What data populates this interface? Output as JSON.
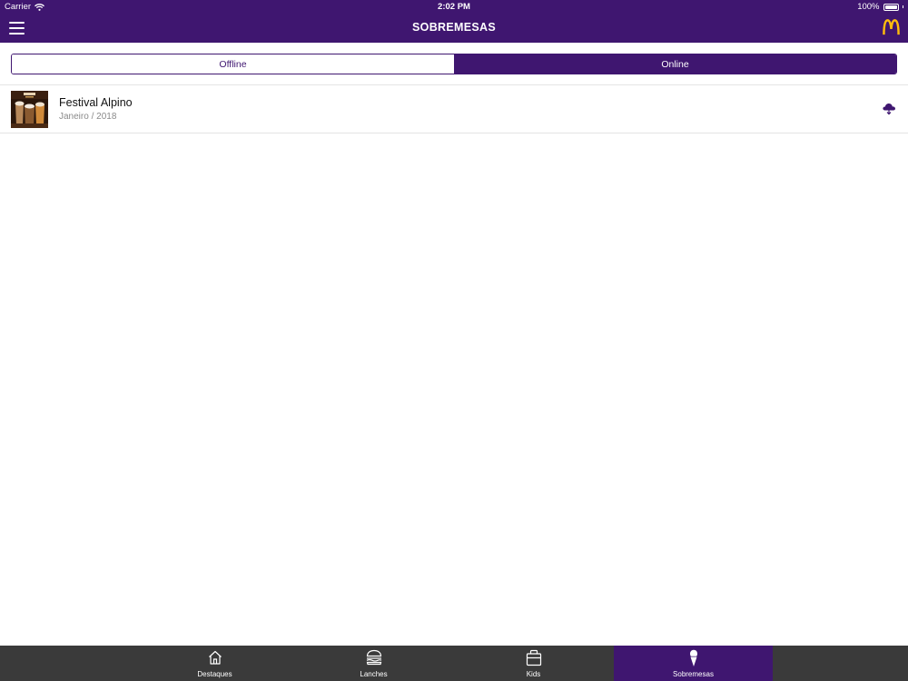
{
  "status_bar": {
    "carrier": "Carrier",
    "time": "2:02 PM",
    "battery": "100%"
  },
  "nav": {
    "title": "SOBREMESAS",
    "menu_icon": "hamburger-menu-icon",
    "logo": "mcdonalds-logo"
  },
  "segments": {
    "offline": "Offline",
    "online": "Online",
    "selected": "Online"
  },
  "items": [
    {
      "title": "Festival Alpino",
      "subtitle": "Janeiro / 2018",
      "action_icon": "cloud-download-icon"
    }
  ],
  "tabs": [
    {
      "label": "Destaques",
      "icon": "home-icon"
    },
    {
      "label": "Lanches",
      "icon": "burger-icon"
    },
    {
      "label": "Kids",
      "icon": "lunchbox-icon"
    },
    {
      "label": "Sobremesas",
      "icon": "ice-cream-icon"
    }
  ],
  "colors": {
    "brand_purple": "#3f1670",
    "logo_yellow": "#ffbc0d",
    "tabbar_gray": "#3a3a3a"
  }
}
